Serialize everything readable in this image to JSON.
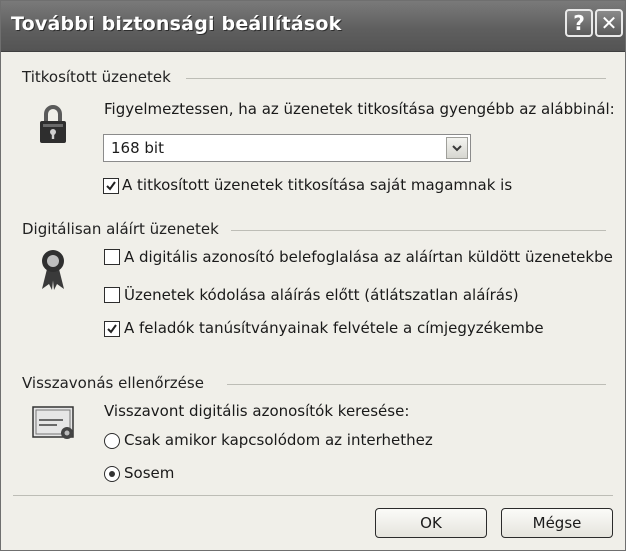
{
  "window": {
    "title": "További biztonsági beállítások",
    "help_label": "?",
    "close_label": "✕"
  },
  "encrypted": {
    "section_label": "Titkosított üzenetek",
    "warning_text": "Figyelmeztessen, ha az üzenetek titkosítása gyengébb az alábbinál:",
    "strength_value": "168 bit",
    "encrypt_self_label": "A titkosított üzenetek titkosítása saját magamnak is",
    "encrypt_self_checked": true
  },
  "signed": {
    "section_label": "Digitálisan aláírt üzenetek",
    "include_id_label": "A digitális azonosító belefoglalása az aláírtan küldött üzenetekbe",
    "include_id_checked": false,
    "encode_label": "Üzenetek kódolása aláírás előtt (átlátszatlan aláírás)",
    "encode_checked": false,
    "add_certs_label": "A feladók tanúsítványainak felvétele a címjegyzékembe",
    "add_certs_checked": true
  },
  "revocation": {
    "section_label": "Visszavonás ellenőrzése",
    "search_text": "Visszavont digitális azonosítók keresése:",
    "online_label": "Csak amikor kapcsolódom az interhethez",
    "never_label": "Sosem",
    "selected": "never"
  },
  "buttons": {
    "ok": "OK",
    "cancel": "Mégse"
  }
}
